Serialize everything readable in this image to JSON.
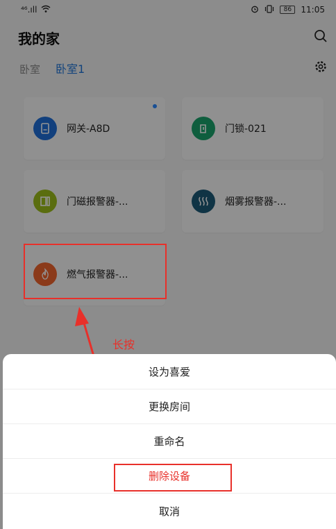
{
  "status_bar": {
    "signal_text": "⁴⁶.ıll",
    "battery": "86",
    "time": "11:05"
  },
  "header": {
    "title": "我的家"
  },
  "rooms": {
    "tabs": [
      {
        "label": "卧室"
      },
      {
        "label": "卧室1"
      }
    ]
  },
  "devices": [
    {
      "label": "网关-A8D",
      "icon": "gateway-icon",
      "color": "#1f6fd8"
    },
    {
      "label": "门锁-021",
      "icon": "door-lock-icon",
      "color": "#1aa36b"
    },
    {
      "label": "门磁报警器-...",
      "icon": "door-sensor-icon",
      "color": "#9bbc1a"
    },
    {
      "label": "烟雾报警器-...",
      "icon": "smoke-alarm-icon",
      "color": "#1c5a78"
    },
    {
      "label": "燃气报警器-...",
      "icon": "gas-alarm-icon",
      "color": "#f0642e"
    }
  ],
  "annotation": {
    "text": "长按"
  },
  "action_sheet": {
    "items": [
      {
        "label": "设为喜爱"
      },
      {
        "label": "更换房间"
      },
      {
        "label": "重命名"
      },
      {
        "label": "删除设备"
      },
      {
        "label": "取消"
      }
    ]
  },
  "colors": {
    "accent": "#1f74d6",
    "annotation_red": "#e8302a"
  }
}
